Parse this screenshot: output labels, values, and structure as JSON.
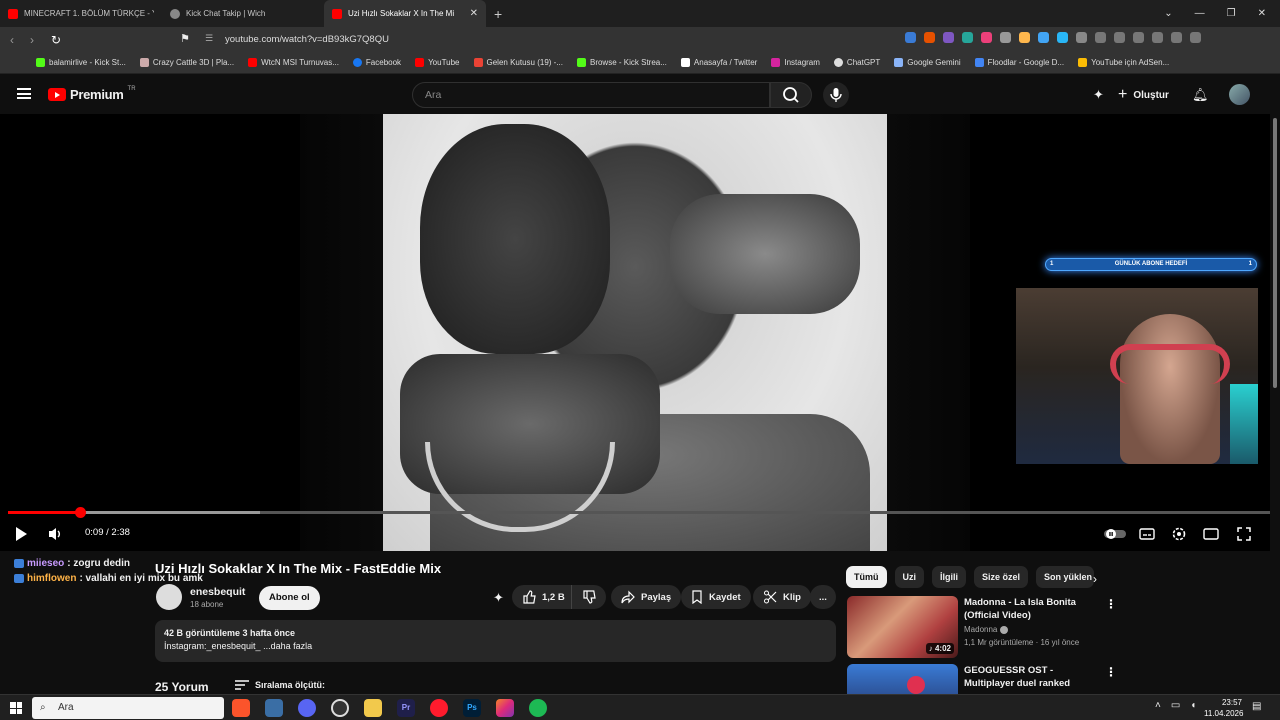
{
  "browser": {
    "tabs": [
      {
        "label": "MINECRAFT 1. BÖLÜM TÜRKÇE - You",
        "icon": "youtube-icon",
        "active": false
      },
      {
        "label": "Kick Chat Takip | Wich",
        "icon": "globe-icon",
        "active": false
      },
      {
        "label": "Uzi Hızlı Sokaklar X In The Mi",
        "icon": "youtube-icon",
        "active": true
      }
    ],
    "new_tab": "+",
    "url": "youtube.com/watch?v=dB93kG7Q8QU",
    "bookmarks": [
      "balamirlive - Kick St...",
      "Crazy Cattle 3D | Pla...",
      "WtcN MSI Turnuvas...",
      "Facebook",
      "YouTube",
      "Gelen Kutusu (19) -...",
      "Browse - Kick Strea...",
      "Anasayfa / Twitter",
      "Instagram",
      "ChatGPT",
      "Google Gemini",
      "Floodlar - Google D...",
      "YouTube için AdSen..."
    ]
  },
  "youtube": {
    "logo": "Premium",
    "logo_sup": "TR",
    "search_placeholder": "Ara",
    "create_label": "Oluştur"
  },
  "player": {
    "time": "0:09 / 2:38",
    "progress": 0.057,
    "buffered": 0.2,
    "overlay": {
      "goal_label": "GÜNLÜK ABONE HEDEFİ",
      "goal_left": "1",
      "goal_right": "1"
    }
  },
  "chat_overlay": [
    {
      "user": "miieseo",
      "message": ": zogru dedin"
    },
    {
      "user": "himflowen",
      "message": ": vallahi en iyi mix bu amk"
    }
  ],
  "video": {
    "title": "Uzi Hızlı Sokaklar X In The Mix - FastEddie Mix",
    "channel": "enesbequit",
    "subscribers": "18 abone",
    "subscribe_label": "Abone ol",
    "likes": "1,2 B",
    "share_label": "Paylaş",
    "save_label": "Kaydet",
    "clip_label": "Klip",
    "more_label": "...",
    "description_stats": "42 B görüntüleme  3 hafta önce",
    "description_text": "İnstagram:_enesbequit_ ...daha fazla",
    "comments_count": "25 Yorum",
    "sort_label": "Sıralama ölçütü:"
  },
  "sidebar": {
    "chips": [
      "Tümü",
      "Uzi",
      "İlgili",
      "Size özel",
      "Son yüklen"
    ],
    "recommendations": [
      {
        "title": "Madonna - La Isla Bonita (Official Video)",
        "channel": "Madonna",
        "meta": "1,1 Mr görüntüleme · 16 yıl önce",
        "duration": "4:02"
      },
      {
        "title": "GEOGUESSR OST - Multiplayer duel ranked",
        "channel": "",
        "meta": "",
        "duration": ""
      }
    ]
  },
  "taskbar": {
    "search_placeholder": "Ara",
    "time": "23:57",
    "date": "11.04.2026"
  }
}
